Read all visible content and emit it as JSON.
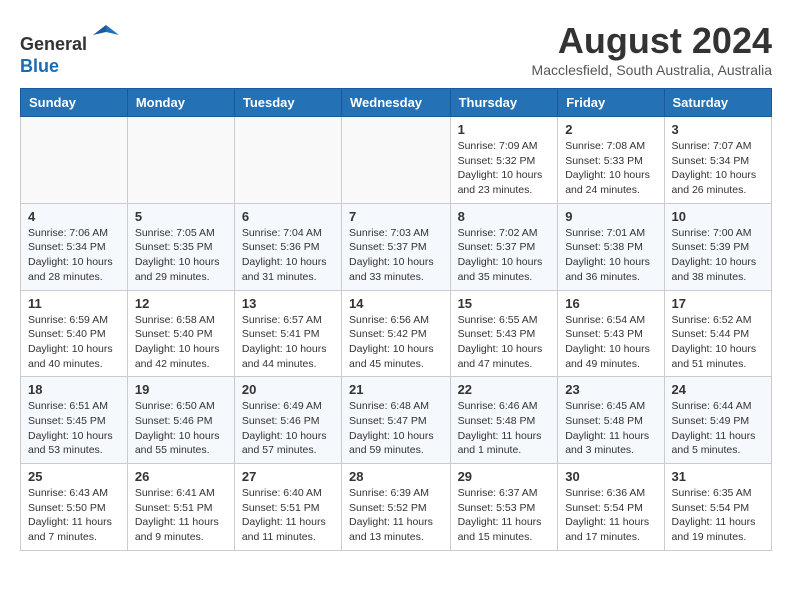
{
  "header": {
    "logo_line1": "General",
    "logo_line2": "Blue",
    "month_year": "August 2024",
    "location": "Macclesfield, South Australia, Australia"
  },
  "weekdays": [
    "Sunday",
    "Monday",
    "Tuesday",
    "Wednesday",
    "Thursday",
    "Friday",
    "Saturday"
  ],
  "weeks": [
    [
      {
        "day": "",
        "info": ""
      },
      {
        "day": "",
        "info": ""
      },
      {
        "day": "",
        "info": ""
      },
      {
        "day": "",
        "info": ""
      },
      {
        "day": "1",
        "info": "Sunrise: 7:09 AM\nSunset: 5:32 PM\nDaylight: 10 hours\nand 23 minutes."
      },
      {
        "day": "2",
        "info": "Sunrise: 7:08 AM\nSunset: 5:33 PM\nDaylight: 10 hours\nand 24 minutes."
      },
      {
        "day": "3",
        "info": "Sunrise: 7:07 AM\nSunset: 5:34 PM\nDaylight: 10 hours\nand 26 minutes."
      }
    ],
    [
      {
        "day": "4",
        "info": "Sunrise: 7:06 AM\nSunset: 5:34 PM\nDaylight: 10 hours\nand 28 minutes."
      },
      {
        "day": "5",
        "info": "Sunrise: 7:05 AM\nSunset: 5:35 PM\nDaylight: 10 hours\nand 29 minutes."
      },
      {
        "day": "6",
        "info": "Sunrise: 7:04 AM\nSunset: 5:36 PM\nDaylight: 10 hours\nand 31 minutes."
      },
      {
        "day": "7",
        "info": "Sunrise: 7:03 AM\nSunset: 5:37 PM\nDaylight: 10 hours\nand 33 minutes."
      },
      {
        "day": "8",
        "info": "Sunrise: 7:02 AM\nSunset: 5:37 PM\nDaylight: 10 hours\nand 35 minutes."
      },
      {
        "day": "9",
        "info": "Sunrise: 7:01 AM\nSunset: 5:38 PM\nDaylight: 10 hours\nand 36 minutes."
      },
      {
        "day": "10",
        "info": "Sunrise: 7:00 AM\nSunset: 5:39 PM\nDaylight: 10 hours\nand 38 minutes."
      }
    ],
    [
      {
        "day": "11",
        "info": "Sunrise: 6:59 AM\nSunset: 5:40 PM\nDaylight: 10 hours\nand 40 minutes."
      },
      {
        "day": "12",
        "info": "Sunrise: 6:58 AM\nSunset: 5:40 PM\nDaylight: 10 hours\nand 42 minutes."
      },
      {
        "day": "13",
        "info": "Sunrise: 6:57 AM\nSunset: 5:41 PM\nDaylight: 10 hours\nand 44 minutes."
      },
      {
        "day": "14",
        "info": "Sunrise: 6:56 AM\nSunset: 5:42 PM\nDaylight: 10 hours\nand 45 minutes."
      },
      {
        "day": "15",
        "info": "Sunrise: 6:55 AM\nSunset: 5:43 PM\nDaylight: 10 hours\nand 47 minutes."
      },
      {
        "day": "16",
        "info": "Sunrise: 6:54 AM\nSunset: 5:43 PM\nDaylight: 10 hours\nand 49 minutes."
      },
      {
        "day": "17",
        "info": "Sunrise: 6:52 AM\nSunset: 5:44 PM\nDaylight: 10 hours\nand 51 minutes."
      }
    ],
    [
      {
        "day": "18",
        "info": "Sunrise: 6:51 AM\nSunset: 5:45 PM\nDaylight: 10 hours\nand 53 minutes."
      },
      {
        "day": "19",
        "info": "Sunrise: 6:50 AM\nSunset: 5:46 PM\nDaylight: 10 hours\nand 55 minutes."
      },
      {
        "day": "20",
        "info": "Sunrise: 6:49 AM\nSunset: 5:46 PM\nDaylight: 10 hours\nand 57 minutes."
      },
      {
        "day": "21",
        "info": "Sunrise: 6:48 AM\nSunset: 5:47 PM\nDaylight: 10 hours\nand 59 minutes."
      },
      {
        "day": "22",
        "info": "Sunrise: 6:46 AM\nSunset: 5:48 PM\nDaylight: 11 hours\nand 1 minute."
      },
      {
        "day": "23",
        "info": "Sunrise: 6:45 AM\nSunset: 5:48 PM\nDaylight: 11 hours\nand 3 minutes."
      },
      {
        "day": "24",
        "info": "Sunrise: 6:44 AM\nSunset: 5:49 PM\nDaylight: 11 hours\nand 5 minutes."
      }
    ],
    [
      {
        "day": "25",
        "info": "Sunrise: 6:43 AM\nSunset: 5:50 PM\nDaylight: 11 hours\nand 7 minutes."
      },
      {
        "day": "26",
        "info": "Sunrise: 6:41 AM\nSunset: 5:51 PM\nDaylight: 11 hours\nand 9 minutes."
      },
      {
        "day": "27",
        "info": "Sunrise: 6:40 AM\nSunset: 5:51 PM\nDaylight: 11 hours\nand 11 minutes."
      },
      {
        "day": "28",
        "info": "Sunrise: 6:39 AM\nSunset: 5:52 PM\nDaylight: 11 hours\nand 13 minutes."
      },
      {
        "day": "29",
        "info": "Sunrise: 6:37 AM\nSunset: 5:53 PM\nDaylight: 11 hours\nand 15 minutes."
      },
      {
        "day": "30",
        "info": "Sunrise: 6:36 AM\nSunset: 5:54 PM\nDaylight: 11 hours\nand 17 minutes."
      },
      {
        "day": "31",
        "info": "Sunrise: 6:35 AM\nSunset: 5:54 PM\nDaylight: 11 hours\nand 19 minutes."
      }
    ]
  ]
}
